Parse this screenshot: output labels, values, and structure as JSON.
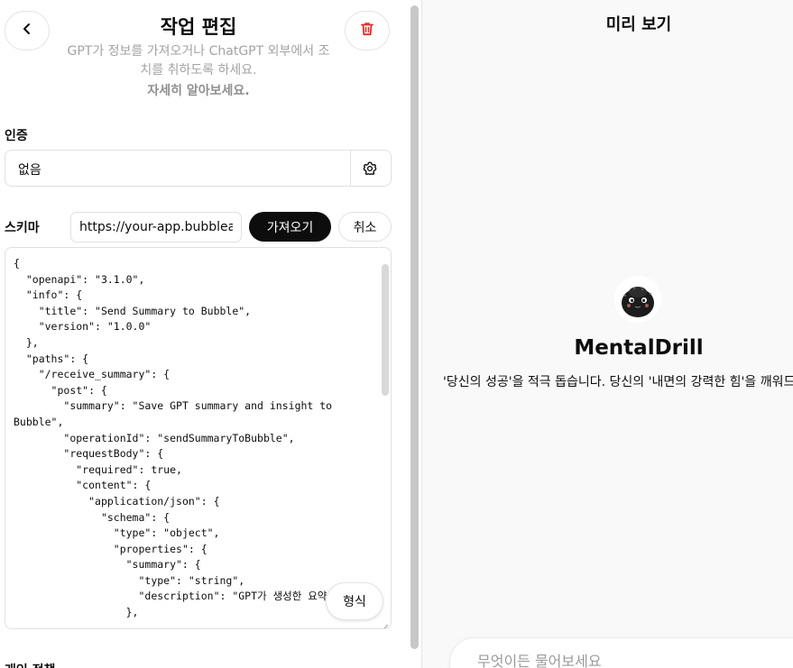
{
  "editor": {
    "title": "작업 편집",
    "subtitle": "GPT가 정보를 가져오거나 ChatGPT 외부에서 조치를 취하도록 하세요.",
    "learn_more": "자세히 알아보세요.",
    "auth": {
      "label": "인증",
      "value": "없음"
    },
    "schema": {
      "label": "스키마",
      "url_value": "https://your-app.bubbleapps.io",
      "import_label": "가져오기",
      "cancel_label": "취소",
      "format_label": "형식",
      "text": "{\n  \"openapi\": \"3.1.0\",\n  \"info\": {\n    \"title\": \"Send Summary to Bubble\",\n    \"version\": \"1.0.0\"\n  },\n  \"paths\": {\n    \"/receive_summary\": {\n      \"post\": {\n        \"summary\": \"Save GPT summary and insight to Bubble\",\n        \"operationId\": \"sendSummaryToBubble\",\n        \"requestBody\": {\n          \"required\": true,\n          \"content\": {\n            \"application/json\": {\n              \"schema\": {\n                \"type\": \"object\",\n                \"properties\": {\n                  \"summary\": {\n                    \"type\": \"string\",\n                    \"description\": \"GPT가 생성한 요약\"\n                  },"
    },
    "next_section_label": "개인 정책"
  },
  "preview": {
    "title": "미리 보기",
    "gpt_name": "MentalDrill",
    "description": "'당신의 성공'을 적극 돕습니다. 당신의 '내면의 강력한 힘'을 깨워드려요!!!",
    "composer_placeholder": "무엇이든 물어보세요"
  },
  "icons": {
    "back": "chevron-left-icon",
    "delete": "trash-icon",
    "settings": "gear-icon"
  },
  "colors": {
    "delete_red": "#e02e2a",
    "primary_button": "#0d0d0d",
    "muted_text": "#a3a3a3"
  }
}
